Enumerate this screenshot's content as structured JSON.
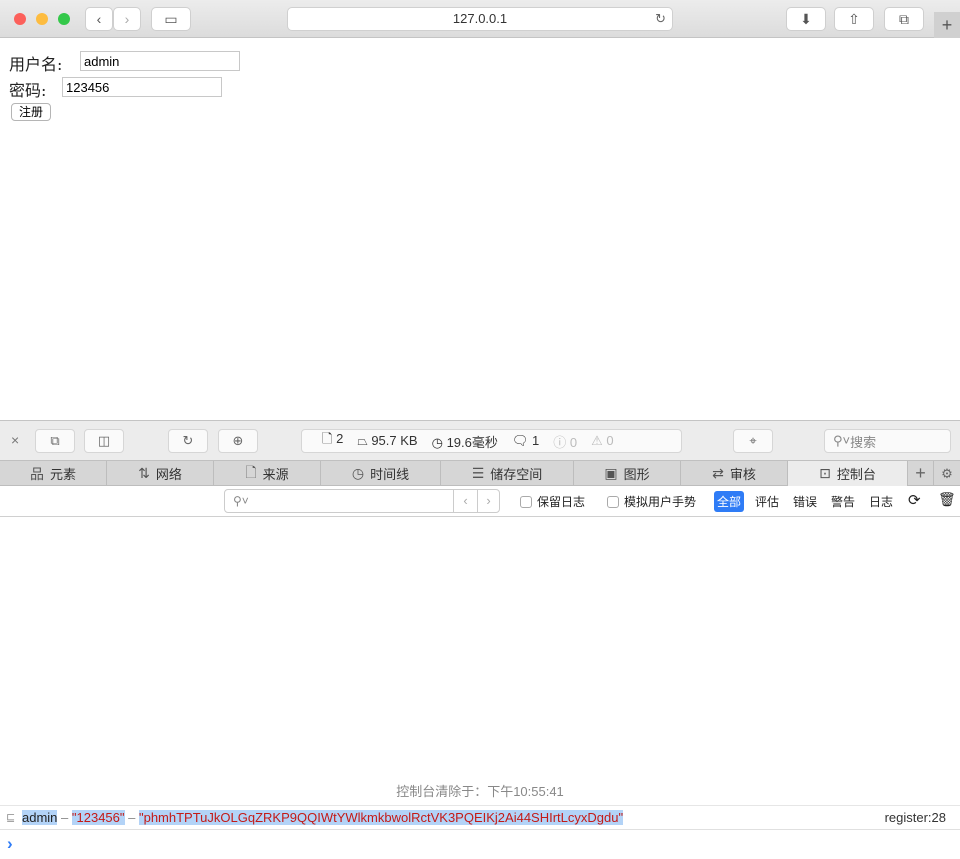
{
  "browser": {
    "url": "127.0.0.1"
  },
  "page": {
    "username_label": "用户名:",
    "username_value": "admin",
    "password_label": "密码:",
    "password_value": "123456",
    "register_button": "注册"
  },
  "devtools": {
    "stats": {
      "resources": "2",
      "size": "95.7 KB",
      "time": "19.6毫秒",
      "logs": "1",
      "errors": "0",
      "warnings": "0"
    },
    "search_placeholder": "搜索",
    "tabs": [
      {
        "label": "元素",
        "icon": "elements-icon"
      },
      {
        "label": "网络",
        "icon": "network-icon"
      },
      {
        "label": "来源",
        "icon": "sources-icon"
      },
      {
        "label": "时间线",
        "icon": "timeline-icon"
      },
      {
        "label": "储存空间",
        "icon": "storage-icon"
      },
      {
        "label": "图形",
        "icon": "graphics-icon"
      },
      {
        "label": "审核",
        "icon": "audit-icon"
      },
      {
        "label": "控制台",
        "icon": "console-icon",
        "selected": true
      }
    ],
    "filter": {
      "preserve_log": "保留日志",
      "emulate_gesture": "模拟用户手势",
      "levels": [
        "全部",
        "评估",
        "错误",
        "警告",
        "日志"
      ],
      "active_level": "全部"
    },
    "console": {
      "cleared": "控制台清除于：下午10:55:41",
      "log": {
        "v1": "admin",
        "sep": " – ",
        "v2": "\"123456\"",
        "v3": "\"phmhTPTuJkOLGqZRKP9QQIWtYWlkmkbwolRctVK3PQEIKj2Ai44SHIrtLcyxDgdu\"",
        "source": "register:28"
      },
      "prompt": "›"
    }
  },
  "colors": {
    "accent": "#2f7cf6",
    "string": "#c41a16",
    "selection": "#b3d3f7"
  }
}
